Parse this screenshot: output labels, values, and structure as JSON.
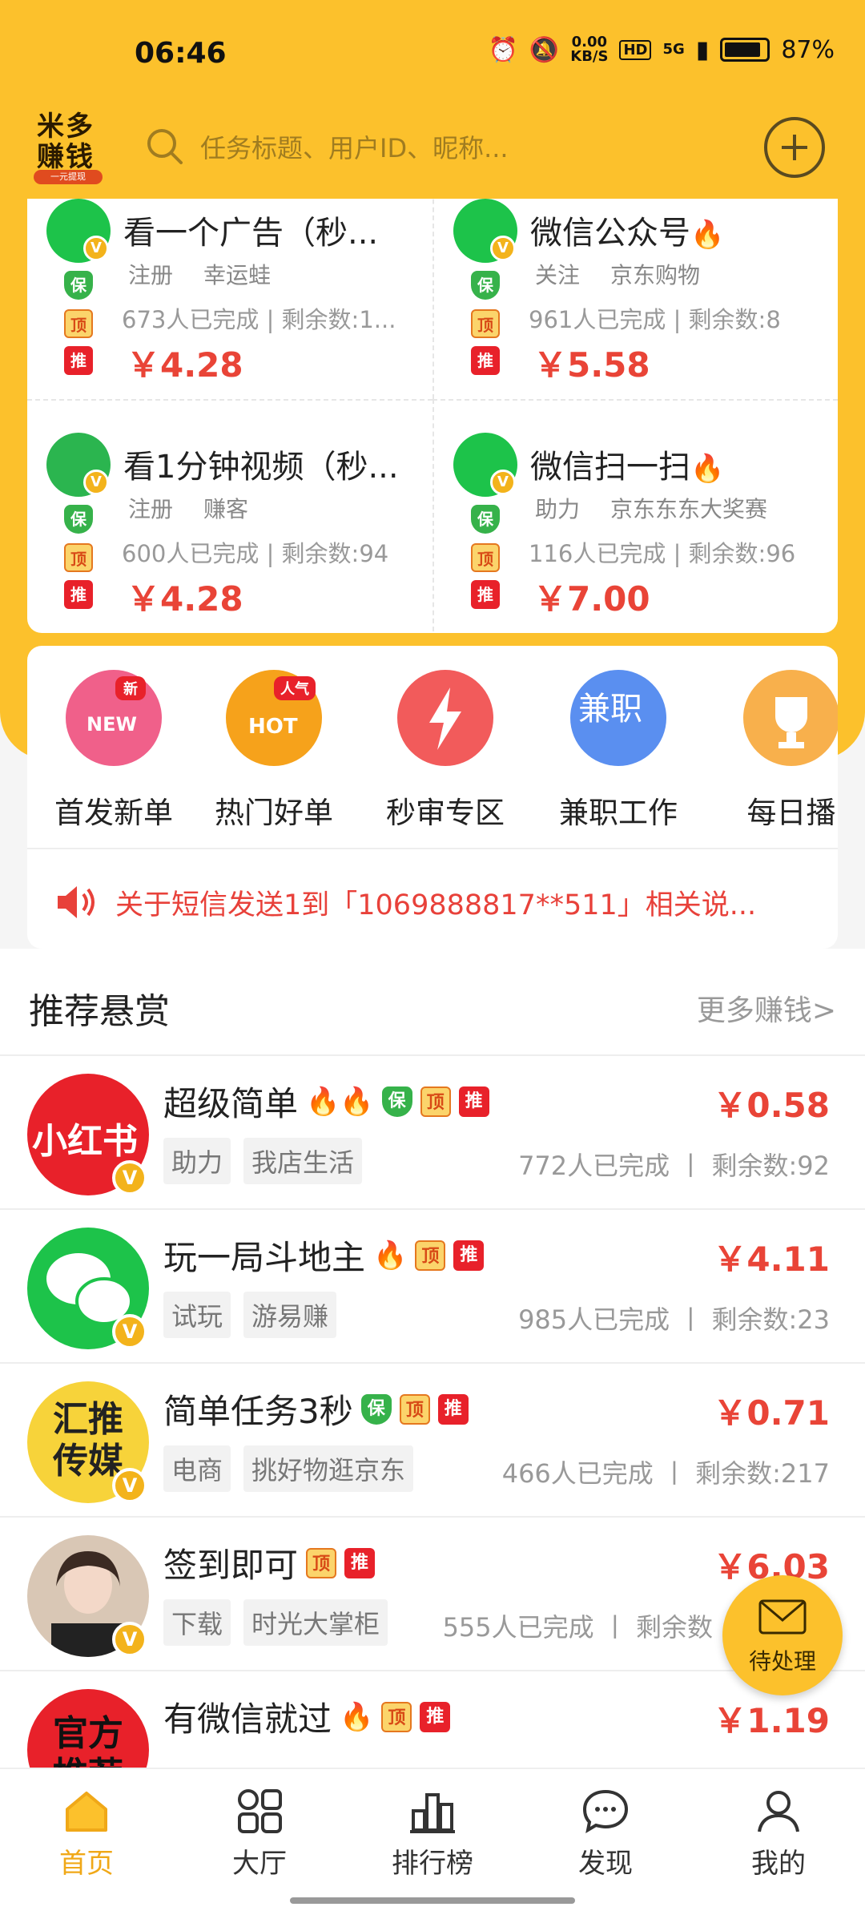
{
  "status_bar": {
    "time": "06:46",
    "net_speed": "0.00\nKB/S",
    "hd": "HD",
    "signal": "5G",
    "battery": "87%"
  },
  "header": {
    "logo_line1": "米多",
    "logo_line2": "赚钱",
    "logo_tag": "一元提现",
    "search_placeholder": "任务标题、用户ID、昵称..."
  },
  "grid_tasks": [
    {
      "title": "看一个广告（秒...",
      "tag1": "注册",
      "tag2": "幸运蛙",
      "stats": "673人已完成 | 剩余数:1...",
      "price": "￥4.28",
      "icon": "wechat-icon"
    },
    {
      "title": "微信公众号",
      "tag1": "关注",
      "tag2": "京东购物",
      "stats": "961人已完成 | 剩余数:8",
      "price": "￥5.58",
      "icon": "wechat-icon"
    },
    {
      "title": "看1分钟视频（秒...",
      "tag1": "注册",
      "tag2": "赚客",
      "stats": "600人已完成 | 剩余数:94",
      "price": "￥4.28",
      "icon": "check-icon"
    },
    {
      "title": "微信扫一扫",
      "tag1": "助力",
      "tag2": "京东东东大奖赛",
      "stats": "116人已完成 | 剩余数:96",
      "price": "￥7.00",
      "icon": "wechat-icon"
    }
  ],
  "badges": {
    "bao": "保",
    "ding": "顶",
    "tui": "推",
    "v": "V"
  },
  "categories": [
    {
      "label": "首发新单",
      "icon": "new-icon",
      "text": "NEW",
      "tag": "新",
      "color": "#f0608a"
    },
    {
      "label": "热门好单",
      "icon": "hot-icon",
      "text": "HOT",
      "tag": "人气",
      "color": "#f6a21b"
    },
    {
      "label": "秒审专区",
      "icon": "lightning-icon",
      "text": "",
      "tag": "",
      "color": "#f25b5b"
    },
    {
      "label": "兼职工作",
      "icon": "job-icon",
      "text": "兼职",
      "tag": "",
      "color": "#5a8ff0"
    },
    {
      "label": "每日播",
      "icon": "trophy-icon",
      "text": "",
      "tag": "",
      "color": "#f8b04c"
    }
  ],
  "notice": {
    "text": "关于短信发送1到「1069888817**511」相关说..."
  },
  "recommend": {
    "title": "推荐悬赏",
    "more": "更多赚钱>"
  },
  "rec_rows": [
    {
      "title": "超级简单",
      "tag1": "助力",
      "tag2": "我店生活",
      "stats": "772人已完成 丨 剩余数:92",
      "price": "￥0.58",
      "avatar": "小红书",
      "avatar_color": "#e8212a"
    },
    {
      "title": "玩一局斗地主",
      "tag1": "试玩",
      "tag2": "游易赚",
      "stats": "985人已完成 丨 剩余数:23",
      "price": "￥4.11",
      "avatar": "",
      "avatar_color": "#1dc34a"
    },
    {
      "title": "简单任务3秒",
      "tag1": "电商",
      "tag2": "挑好物逛京东",
      "stats": "466人已完成 丨 剩余数:217",
      "price": "￥0.71",
      "avatar": "汇推传媒",
      "avatar_color": "#f7d33a"
    },
    {
      "title": "签到即可",
      "tag1": "下载",
      "tag2": "时光大掌柜",
      "stats": "555人已完成 丨 剩余数",
      "price": "￥6.03",
      "avatar": "",
      "avatar_color": "#d9c7b5"
    },
    {
      "title": "有微信就过",
      "tag1": "",
      "tag2": "",
      "stats": "",
      "price": "￥1.19",
      "avatar": "官方推荐",
      "avatar_color": "#e8212a"
    }
  ],
  "float_button": {
    "label": "待处理"
  },
  "bottom_nav": [
    {
      "label": "首页",
      "active": true
    },
    {
      "label": "大厅",
      "active": false
    },
    {
      "label": "排行榜",
      "active": false
    },
    {
      "label": "发现",
      "active": false
    },
    {
      "label": "我的",
      "active": false
    }
  ],
  "colors": {
    "brand_yellow": "#fcc12c",
    "price_red": "#e94437",
    "active_nav": "#f0a818"
  }
}
